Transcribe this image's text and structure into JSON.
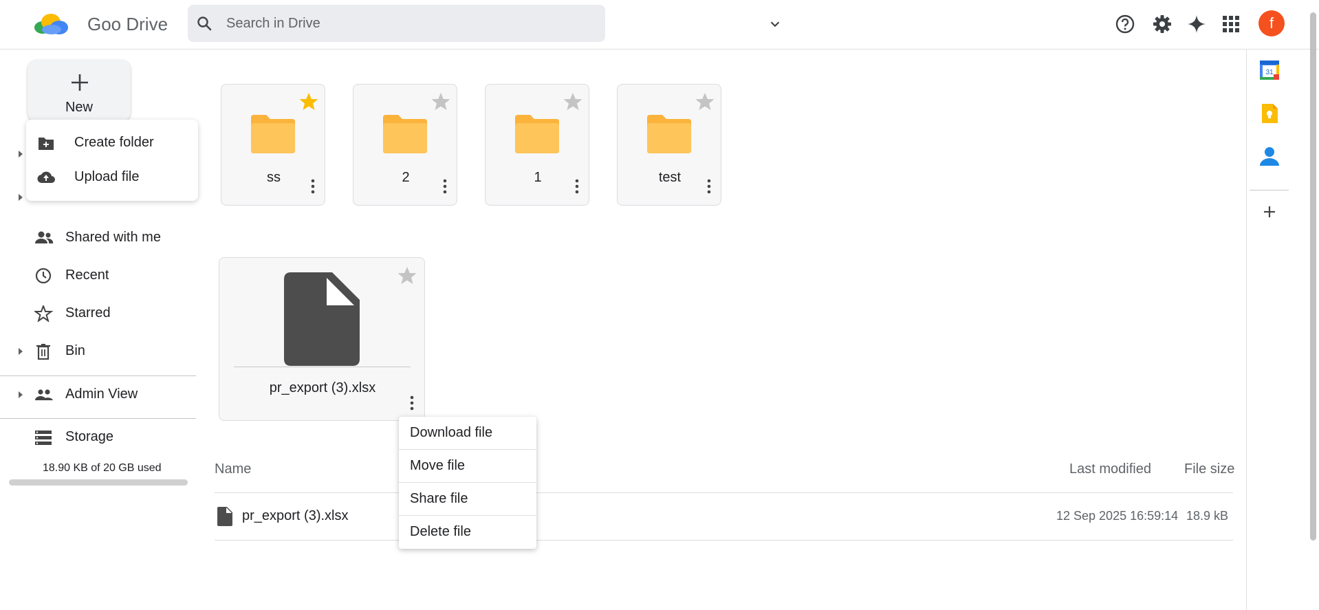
{
  "header": {
    "app_title": "Goo Drive",
    "search_placeholder": "Search in Drive",
    "icons": [
      "help-icon",
      "settings-icon",
      "sparkle-icon",
      "apps-grid-icon"
    ],
    "avatar_letter": "f",
    "avatar_color": "#f4511e"
  },
  "sidebar": {
    "new_label": "New",
    "new_menu": [
      {
        "label": "Create folder",
        "icon": "create-folder-icon"
      },
      {
        "label": "Upload file",
        "icon": "upload-icon"
      }
    ],
    "nav": [
      {
        "label": "Shared with me",
        "icon": "people-icon"
      },
      {
        "label": "Recent",
        "icon": "clock-icon"
      },
      {
        "label": "Starred",
        "icon": "star-outline-icon"
      },
      {
        "label": "Bin",
        "icon": "trash-icon"
      },
      {
        "label": "Admin View",
        "icon": "admin-people-icon"
      },
      {
        "label": "Storage",
        "icon": "storage-icon"
      }
    ],
    "storage_text": "18.90 KB of 20 GB used",
    "storage_used_fraction": 1e-06
  },
  "folders": [
    {
      "name": "ss",
      "starred": true
    },
    {
      "name": "2",
      "starred": false
    },
    {
      "name": "1",
      "starred": false
    },
    {
      "name": "test",
      "starred": false
    }
  ],
  "files": [
    {
      "name": "pr_export (3).xlsx",
      "starred": false
    }
  ],
  "context_menu": [
    "Download file",
    "Move file",
    "Share file",
    "Delete file"
  ],
  "table": {
    "headers": {
      "name": "Name",
      "modified": "Last modified",
      "size": "File size"
    },
    "rows": [
      {
        "name": "pr_export (3).xlsx",
        "modified": "12 Sep 2025 16:59:14",
        "size": "18.9 kB"
      }
    ]
  },
  "right_rail": [
    "calendar-icon",
    "keep-icon",
    "contacts-icon",
    "add-icon"
  ],
  "colors": {
    "folder": "#fdc14a",
    "star_active": "#fbbc04",
    "star_inactive": "#c4c4c4",
    "accent": "#1a73e8"
  }
}
